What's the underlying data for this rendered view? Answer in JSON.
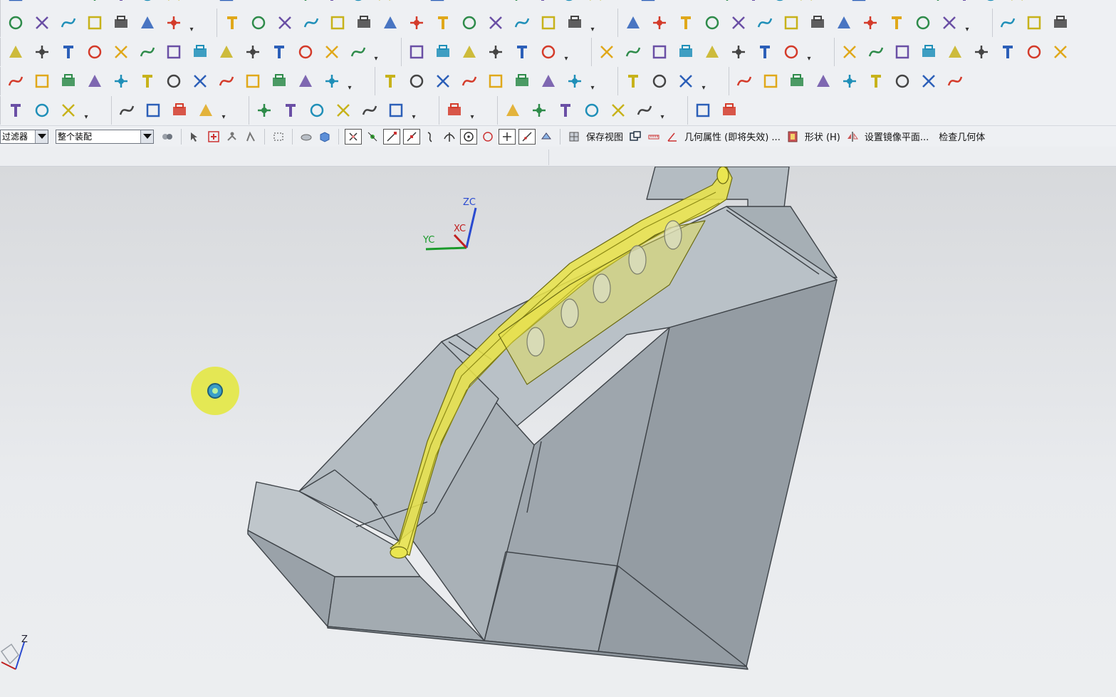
{
  "selection_bar": {
    "filter_label": "过滤器",
    "scope_label": "整个装配",
    "save_view": "保存视图",
    "geometry_properties": "几何属性 (即将失效) ...",
    "shape_menu": "形状 (H)",
    "set_mirror_plane": "设置镜像平面...",
    "check_geometry": "检查几何体"
  },
  "viewport": {
    "wcs_labels": {
      "zc": "ZC",
      "xc": "XC",
      "yc": "YC"
    },
    "triad_label": "Z"
  },
  "colors": {
    "toolbar_bg": "#eef0f3",
    "viewport_top": "#d7d9dc",
    "mold_block": "#a9b1b8",
    "part_yellow": "#e8e24a",
    "cursor_highlight": "#e4e83a"
  },
  "toolbar_rows": {
    "row1": [
      "select-icon",
      "snap-point-icon",
      "snap-end-icon",
      "snap-mid-icon",
      "dimension-icon",
      "ruler-icon",
      "grid-icon",
      "line-icon",
      "arc-icon",
      "rectangle-icon",
      "spline-icon",
      "text-icon",
      "curve-rotate-icon",
      "profile-icon",
      "extrude-curve-icon",
      "helix-icon",
      "sweep-icon",
      "mirror-curve-icon",
      "section-icon",
      "wireframe-icon",
      "surface-blue-icon",
      "mesh-surface-icon",
      "grid-surface-icon",
      "patch-icon",
      "offset-surface-icon",
      "trim-surface-icon",
      "blend-surface-icon",
      "cylinder-yellow-icon",
      "face-icon",
      "layer-icon",
      "measure-icon",
      "solid-icon",
      "shape-icon",
      "wedge-icon",
      "book-icon",
      "tools-icon",
      "pipe-icon"
    ],
    "row2": [
      "y-icon",
      "circle-icon",
      "mold-base-icon",
      "ejector-icon",
      "pin-icon",
      "support-icon",
      "gate-icon",
      "slider-icon",
      "lifter-icon",
      "cooling-icon",
      "sprue-icon",
      "insert-icon",
      "pocket-icon",
      "electrode-icon",
      "mold-tool-1",
      "mold-tool-2",
      "mold-tool-3",
      "mold-tool-4",
      "mold-tool-5",
      "mold-tool-6",
      "mold-tool-7",
      "mold-tool-8",
      "mold-tool-9",
      "mold-tool-10",
      "mold-tool-11",
      "mold-tool-12",
      "mold-tool-13",
      "mold-tool-14",
      "mold-tool-15",
      "mold-tool-16",
      "mold-tool-17",
      "mold-tool-18",
      "mold-tool-19",
      "mold-tool-20",
      "mold-tool-21",
      "mold-tool-22",
      "mold-tool-23"
    ],
    "row3": [
      "cube-icon",
      "color-grid-icon",
      "assembly-icon",
      "red-box-icon",
      "boundary-icon",
      "extrude-icon",
      "sheet-icon",
      "split-icon",
      "offset-face-icon",
      "axis-icon",
      "coordinate-icon",
      "f8-icon",
      "x-bar-icon",
      "datum-tool-1",
      "datum-tool-2",
      "datum-tool-3",
      "datum-tool-4",
      "datum-tool-5",
      "datum-tool-6",
      "datum-tool-7",
      "datum-tool-8",
      "lightning-icon",
      "forbidden-icon",
      "star-pen-icon",
      "palette-icon",
      "orange-cube-icon",
      "orange-face-icon",
      "shaded-cube-icon",
      "s-curve-icon",
      "white-cube-icon",
      "annotate-icon",
      "csys-icon",
      "component-icon"
    ],
    "row4": [
      "book-set-icon",
      "books-icon",
      "x-mark-icon",
      "fillet-1",
      "fillet-2",
      "fillet-3",
      "fillet-4",
      "layout-1",
      "layout-2",
      "layout-3",
      "layout-4",
      "layout-5",
      "layout-6",
      "list-icon",
      "line-tool-1",
      "line-tool-2",
      "rotate-icon",
      "angle-icon",
      "perpendicular-icon",
      "revolve-icon",
      "vector-icon",
      "grid-blocks-icon"
    ]
  }
}
